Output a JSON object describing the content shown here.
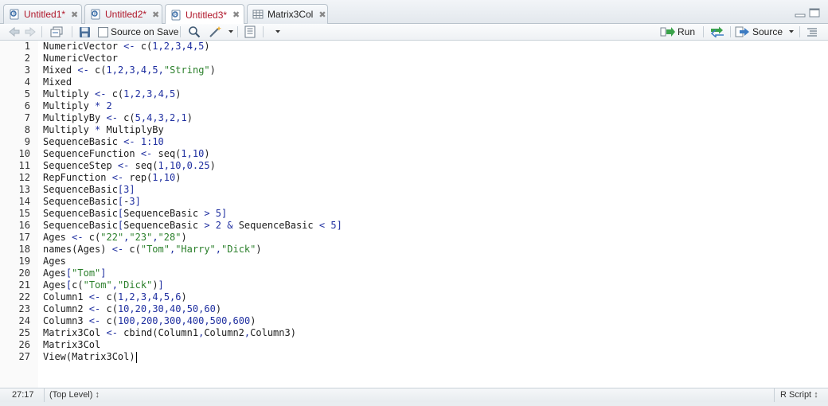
{
  "tabs": [
    {
      "label": "Untitled1*",
      "modified": true,
      "icon": "r-script-icon"
    },
    {
      "label": "Untitled2*",
      "modified": true,
      "icon": "r-script-icon"
    },
    {
      "label": "Untitled3*",
      "modified": true,
      "icon": "r-script-icon",
      "active": true
    },
    {
      "label": "Matrix3Col",
      "modified": false,
      "icon": "table-icon"
    }
  ],
  "toolbar": {
    "source_on_save_label": "Source on Save",
    "run_label": "Run",
    "source_label": "Source"
  },
  "editor": {
    "line_numbers": [
      "1",
      "2",
      "3",
      "4",
      "5",
      "6",
      "7",
      "8",
      "9",
      "10",
      "11",
      "12",
      "13",
      "14",
      "15",
      "16",
      "17",
      "18",
      "19",
      "20",
      "21",
      "22",
      "23",
      "24",
      "25",
      "26",
      "27"
    ],
    "lines": [
      "NumericVector <- c(1,2,3,4,5)",
      "NumericVector",
      "Mixed <- c(1,2,3,4,5,\"String\")",
      "Mixed",
      "Multiply <- c(1,2,3,4,5)",
      "Multiply * 2",
      "MultiplyBy <- c(5,4,3,2,1)",
      "Multiply * MultiplyBy",
      "SequenceBasic <- 1:10",
      "SequenceFunction <- seq(1,10)",
      "SequenceStep <- seq(1,10,0.25)",
      "RepFunction <- rep(1,10)",
      "SequenceBasic[3]",
      "SequenceBasic[-3]",
      "SequenceBasic[SequenceBasic > 5]",
      "SequenceBasic[SequenceBasic > 2 & SequenceBasic < 5]",
      "Ages <- c(\"22\",\"23\",\"28\")",
      "names(Ages) <- c(\"Tom\",\"Harry\",\"Dick\")",
      "Ages",
      "Ages[\"Tom\"]",
      "Ages[c(\"Tom\",\"Dick\")]",
      "Column1 <- c(1,2,3,4,5,6)",
      "Column2 <- c(10,20,30,40,50,60)",
      "Column3 <- c(100,200,300,400,500,600)",
      "Matrix3Col <- cbind(Column1,Column2,Column3)",
      "Matrix3Col",
      "View(Matrix3Col)"
    ]
  },
  "status": {
    "position": "27:17",
    "scope": "(Top Level)",
    "file_type": "R Script"
  },
  "colors": {
    "modified_tab": "#b0172a",
    "operator": "#1f2fa0",
    "string": "#2a7f2a"
  }
}
